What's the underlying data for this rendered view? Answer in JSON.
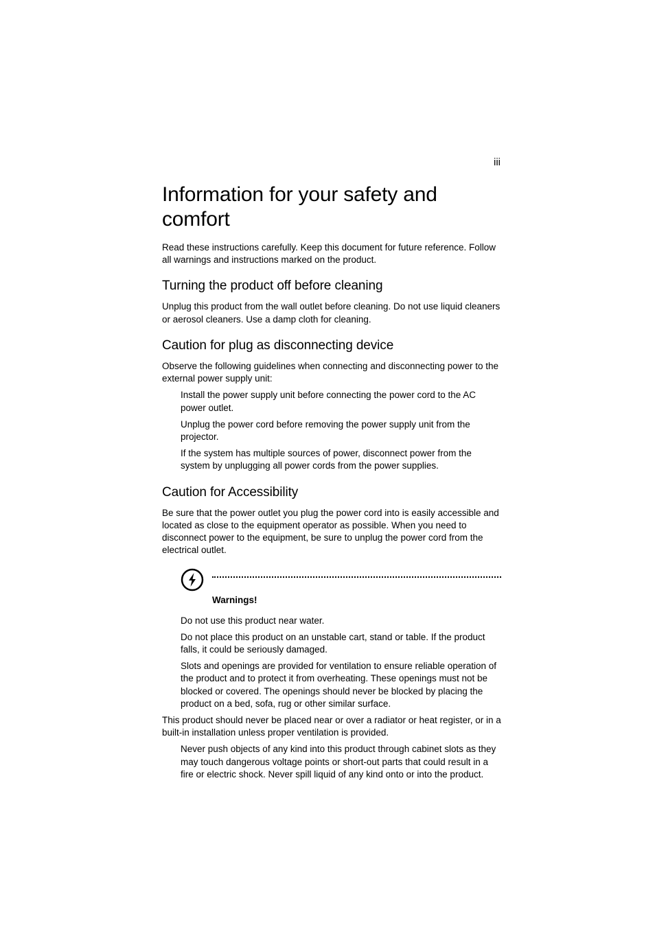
{
  "page_number": "iii",
  "title": "Information for your safety and comfort",
  "intro_para": "Read these instructions carefully. Keep this document for future reference. Follow all warnings and instructions marked on the product.",
  "section1": {
    "heading": "Turning the product off before cleaning",
    "para": "Unplug this product from the wall outlet before cleaning. Do not use liquid cleaners or aerosol cleaners. Use a damp cloth for cleaning."
  },
  "section2": {
    "heading": "Caution for plug as disconnecting device",
    "intro": "Observe the following guidelines when connecting and disconnecting power to the external power supply unit:",
    "b1": "Install the power supply unit before connecting the power cord to the AC power outlet.",
    "b2": "Unplug the power cord before removing the power supply unit from the projector.",
    "b3": "If the system has multiple sources of power, disconnect power from the system by unplugging all power cords from the power supplies."
  },
  "section3": {
    "heading": "Caution for Accessibility",
    "para": "Be sure that the power outlet you plug the power cord into is easily accessible and located as close to the equipment operator as possible. When you need to disconnect power to the equipment, be sure to unplug the power cord from the electrical outlet."
  },
  "warning_label": "Warnings!",
  "warn_bullets": {
    "b1": "Do not use this product near water.",
    "b2": "Do not place this product on an unstable cart, stand or table. If the product falls, it could be seriously damaged.",
    "b3": "Slots and openings are provided for ventilation to ensure reliable operation of the product and to protect it from overheating. These openings must not be blocked or covered. The openings should never be blocked by placing the product on a bed, sofa, rug or other similar surface."
  },
  "mid_para": "This product should never be placed near or over a radiator or heat register, or in a built-in installation unless proper ventilation is provided.",
  "warn_bullets2": {
    "b1": "Never push objects of any kind into this product through cabinet slots as they may touch dangerous voltage points or short-out parts that could result in a fire or electric shock. Never spill liquid of any kind onto or into the product."
  }
}
